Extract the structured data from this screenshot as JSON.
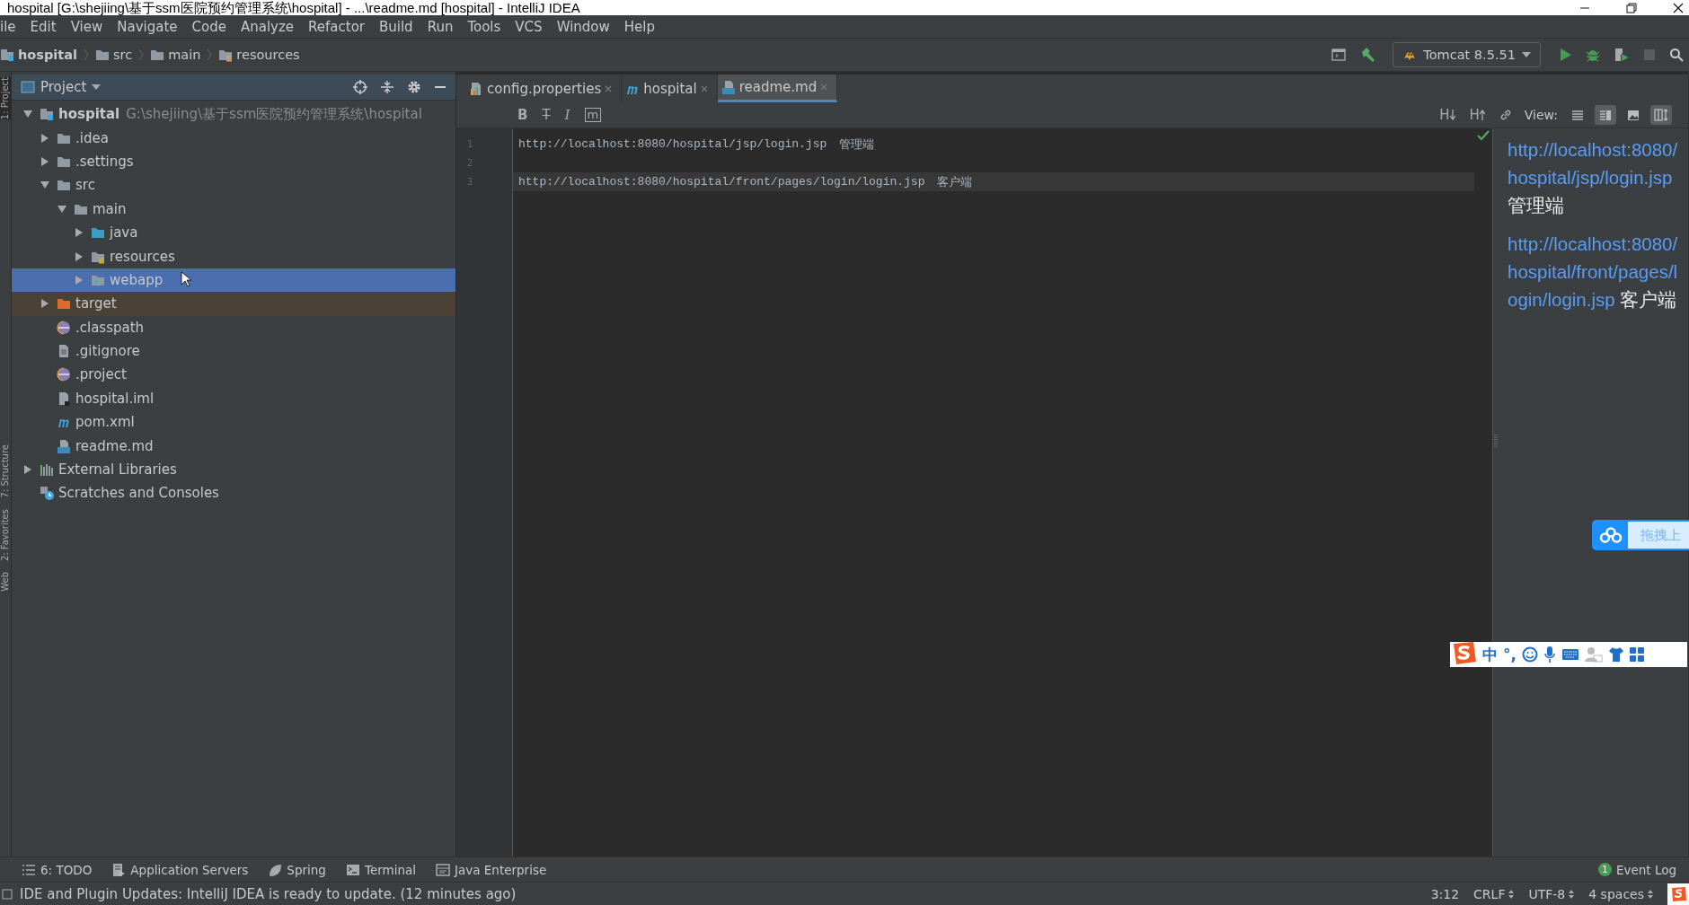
{
  "window": {
    "title": "hospital [G:\\shejiing\\基于ssm医院预约管理系统\\hospital] - ...\\readme.md [hospital] - IntelliJ IDEA"
  },
  "menu": [
    "ile",
    "Edit",
    "View",
    "Navigate",
    "Code",
    "Analyze",
    "Refactor",
    "Build",
    "Run",
    "Tools",
    "VCS",
    "Window",
    "Help"
  ],
  "breadcrumbs": [
    {
      "label": "hospital",
      "kind": "module"
    },
    {
      "label": "src",
      "kind": "folder"
    },
    {
      "label": "main",
      "kind": "folder"
    },
    {
      "label": "resources",
      "kind": "resource-folder"
    }
  ],
  "run_config": {
    "label": "Tomcat 8.5.51"
  },
  "side_stripe": [
    "1: Project",
    "7: Structure",
    "2: Favorites",
    "Web"
  ],
  "project_panel": {
    "title": "Project",
    "tree": [
      {
        "label": "hospital",
        "path": "G:\\shejiing\\基于ssm医院预约管理系统\\hospital",
        "kind": "module",
        "expanded": true,
        "selected": false,
        "children": [
          {
            "label": ".idea",
            "kind": "folder",
            "expanded": false,
            "selected": false
          },
          {
            "label": ".settings",
            "kind": "folder",
            "expanded": false,
            "selected": false
          },
          {
            "label": "src",
            "kind": "folder",
            "expanded": true,
            "selected": false,
            "children": [
              {
                "label": "main",
                "kind": "folder",
                "expanded": true,
                "selected": false,
                "children": [
                  {
                    "label": "java",
                    "kind": "source-folder",
                    "expanded": false,
                    "selected": false
                  },
                  {
                    "label": "resources",
                    "kind": "resource-folder",
                    "expanded": false,
                    "selected": false
                  },
                  {
                    "label": "webapp",
                    "kind": "web-folder",
                    "expanded": false,
                    "selected": true
                  }
                ]
              }
            ]
          },
          {
            "label": "target",
            "kind": "excluded-folder",
            "expanded": false,
            "selected": false
          },
          {
            "label": ".classpath",
            "kind": "eclipse-file",
            "selected": false
          },
          {
            "label": ".gitignore",
            "kind": "text-file",
            "selected": false
          },
          {
            "label": ".project",
            "kind": "eclipse-file",
            "selected": false
          },
          {
            "label": "hospital.iml",
            "kind": "iml-file",
            "selected": false
          },
          {
            "label": "pom.xml",
            "kind": "maven-file",
            "selected": false
          },
          {
            "label": "readme.md",
            "kind": "md-file",
            "selected": false
          }
        ]
      },
      {
        "label": "External Libraries",
        "kind": "libraries",
        "expanded": false,
        "selected": false
      },
      {
        "label": "Scratches and Consoles",
        "kind": "scratches",
        "selected": false
      }
    ]
  },
  "editor": {
    "tabs": [
      {
        "label": "config.properties",
        "kind": "properties",
        "selected": false
      },
      {
        "label": "hospital",
        "kind": "maven",
        "selected": false
      },
      {
        "label": "readme.md",
        "kind": "md",
        "selected": true
      }
    ],
    "md_toolbar": [
      {
        "kind": "bold",
        "glyph": "B"
      },
      {
        "kind": "strike",
        "glyph": "T"
      },
      {
        "kind": "italic",
        "glyph": "I"
      },
      {
        "kind": "code",
        "glyph": "m"
      },
      {
        "kind": "header-down",
        "glyph": "H"
      },
      {
        "kind": "header-up",
        "glyph": "H"
      },
      {
        "kind": "link"
      }
    ],
    "lines": [
      {
        "number": "1",
        "text": "http://localhost:8080/hospital/jsp/login.jsp",
        "note": "管理端",
        "current": false
      },
      {
        "number": "2",
        "current": false
      },
      {
        "number": "3",
        "text": "http://localhost:8080/hospital/front/pages/login/login.jsp",
        "note": "客户端",
        "current": true
      }
    ]
  },
  "preview": {
    "view_label": "View:",
    "view_modes": [
      {
        "kind": "editor",
        "selected": false
      },
      {
        "kind": "split",
        "selected": true
      },
      {
        "kind": "preview",
        "selected": false
      }
    ],
    "paragraphs": [
      {
        "link": "http://localhost:8080/hospital/jsp/login.jsp",
        "note": "管理端"
      },
      {
        "link": "http://localhost:8080/hospital/front/pages/login/login.jsp",
        "note": "客户端"
      }
    ]
  },
  "upload_widget": {
    "label": "拖拽上"
  },
  "ime_bar": {
    "mode": "中",
    "punct": "°,"
  },
  "tool_windows": [
    {
      "label": "6: TODO",
      "kind": "todo"
    },
    {
      "label": "Application Servers",
      "kind": "servers"
    },
    {
      "label": "Spring",
      "kind": "spring"
    },
    {
      "label": "Terminal",
      "kind": "terminal"
    },
    {
      "label": "Java Enterprise",
      "kind": "javaee"
    }
  ],
  "event_log": {
    "count": "1",
    "label": "Event Log"
  },
  "status_bar": {
    "message": "IDE and Plugin Updates: IntelliJ IDEA is ready to update. (12 minutes ago)",
    "items": [
      {
        "label": "3:12",
        "dropdown": false
      },
      {
        "label": "CRLF",
        "dropdown": true
      },
      {
        "label": "UTF-8",
        "dropdown": true
      },
      {
        "label": "4 spaces",
        "dropdown": true
      }
    ]
  }
}
